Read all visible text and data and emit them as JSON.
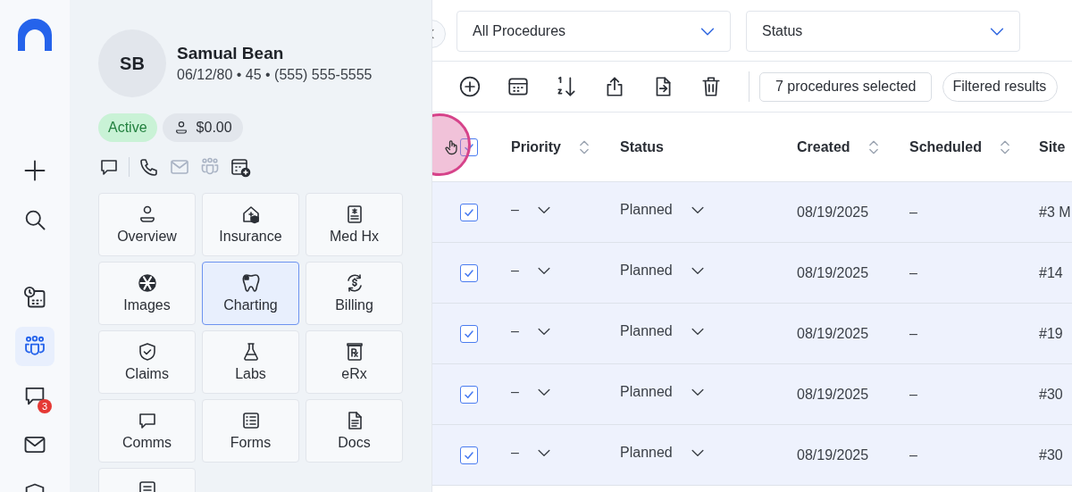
{
  "nav": {
    "items": [
      {
        "selected": false
      },
      {
        "selected": false
      },
      {
        "selected": false
      },
      {
        "selected": true
      },
      {
        "selected": false,
        "badge": "3"
      },
      {
        "selected": false
      },
      {
        "selected": false
      }
    ]
  },
  "patient": {
    "initials": "SB",
    "name": "Samual Bean",
    "details": "06/12/80 • 45 • (555) 555-5555",
    "status": "Active",
    "balance": "$0.00",
    "actions": [
      {
        "disabled": false
      },
      {
        "disabled": false
      },
      {
        "disabled": true
      },
      {
        "disabled": true
      },
      {
        "disabled": false
      }
    ],
    "tiles": [
      {
        "label": "Overview",
        "selected": false
      },
      {
        "label": "Insurance",
        "selected": false
      },
      {
        "label": "Med Hx",
        "selected": false
      },
      {
        "label": "Images",
        "selected": false
      },
      {
        "label": "Charting",
        "selected": true
      },
      {
        "label": "Billing",
        "selected": false
      },
      {
        "label": "Claims",
        "selected": false
      },
      {
        "label": "Labs",
        "selected": false
      },
      {
        "label": "eRx",
        "selected": false
      },
      {
        "label": "Comms",
        "selected": false
      },
      {
        "label": "Forms",
        "selected": false
      },
      {
        "label": "Docs",
        "selected": false
      },
      {
        "selected": false
      }
    ]
  },
  "filters": [
    {
      "value": "All Procedures"
    },
    {
      "value": "Status"
    }
  ],
  "toolbar": {
    "selection": "7 procedures selected",
    "filter": "Filtered results"
  },
  "table": {
    "all_checked": true,
    "columns": [
      {
        "label": "Priority",
        "sortable": true
      },
      {
        "label": "Status",
        "sortable": false
      },
      {
        "label": "Created",
        "sortable": true
      },
      {
        "label": "Scheduled",
        "sortable": true
      },
      {
        "label": "Site",
        "sortable": false
      }
    ],
    "rows": [
      {
        "checked": true,
        "priority": "–",
        "status": "Planned",
        "created": "08/19/2025",
        "scheduled": "–",
        "site": "#3 M"
      },
      {
        "checked": true,
        "priority": "–",
        "status": "Planned",
        "created": "08/19/2025",
        "scheduled": "–",
        "site": "#14"
      },
      {
        "checked": true,
        "priority": "–",
        "status": "Planned",
        "created": "08/19/2025",
        "scheduled": "–",
        "site": "#19"
      },
      {
        "checked": true,
        "priority": "–",
        "status": "Planned",
        "created": "08/19/2025",
        "scheduled": "–",
        "site": "#30"
      },
      {
        "checked": true,
        "priority": "–",
        "status": "Planned",
        "created": "08/19/2025",
        "scheduled": "–",
        "site": "#30"
      }
    ]
  }
}
